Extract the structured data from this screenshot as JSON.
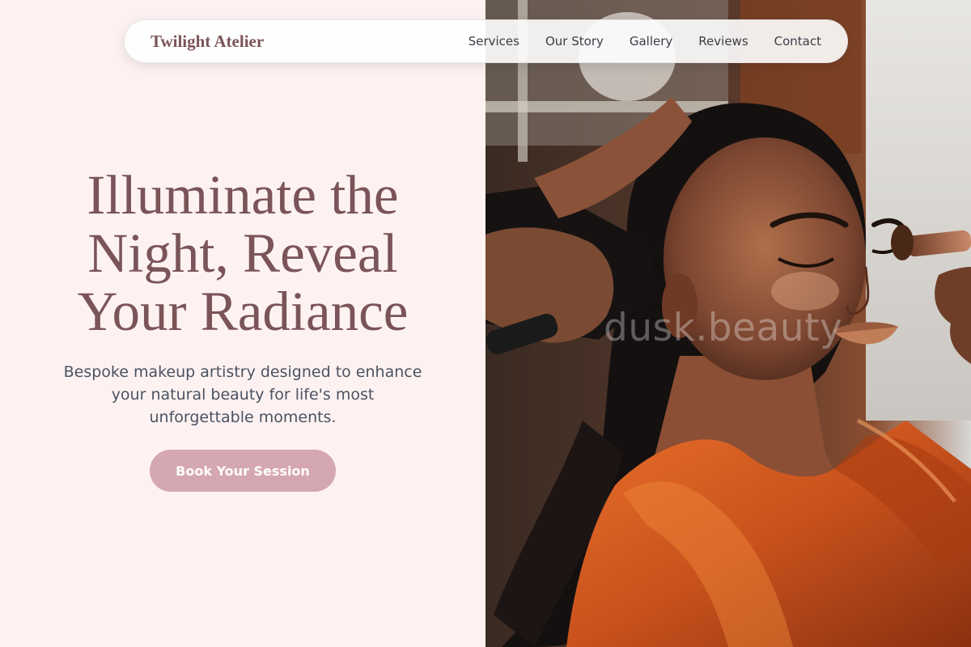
{
  "brand": {
    "name": "Twilight Atelier"
  },
  "nav": {
    "items": [
      {
        "label": "Services"
      },
      {
        "label": "Our Story"
      },
      {
        "label": "Gallery"
      },
      {
        "label": "Reviews"
      },
      {
        "label": "Contact"
      }
    ]
  },
  "hero": {
    "title_lines": [
      "Illuminate the",
      "Night, Reveal",
      "Your Radiance"
    ],
    "subtitle_lines": [
      "Bespoke makeup artistry designed to enhance",
      "your natural beauty for life's most",
      "unforgettable moments."
    ],
    "cta_label": "Book Your Session"
  },
  "photo": {
    "watermark": "dusk.beauty"
  },
  "colors": {
    "background": "#fdf2f1",
    "brand_text": "#7a5458",
    "body_text": "#4a5262",
    "cta": "#d5a7b1",
    "garment": "#c9521d"
  },
  "icons": [
    "photo-makeup-artist-applying-brush"
  ]
}
